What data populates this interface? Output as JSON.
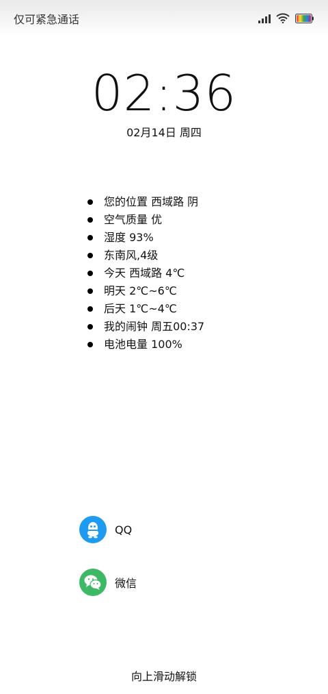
{
  "status_bar": {
    "emergency_text": "仅可紧急通话",
    "icons": [
      "signal-icon",
      "wifi-icon",
      "battery-icon"
    ]
  },
  "lockscreen": {
    "time": "02:36",
    "date": "02月14日 周四",
    "info_items": [
      "您的位置 西域路 阴",
      "空气质量 优",
      "湿度 93%",
      "东南风,4级",
      "今天 西域路 4℃",
      "明天  2℃~6℃",
      "后天  1℃~4℃",
      "我的闹钟 周五00:37",
      "电池电量 100%"
    ],
    "apps": [
      {
        "label": "QQ",
        "icon": "qq-icon",
        "color": "#1E9BF0"
      },
      {
        "label": "微信",
        "icon": "wechat-icon",
        "color": "#3DB865"
      }
    ],
    "unlock_hint": "向上滑动解锁"
  }
}
